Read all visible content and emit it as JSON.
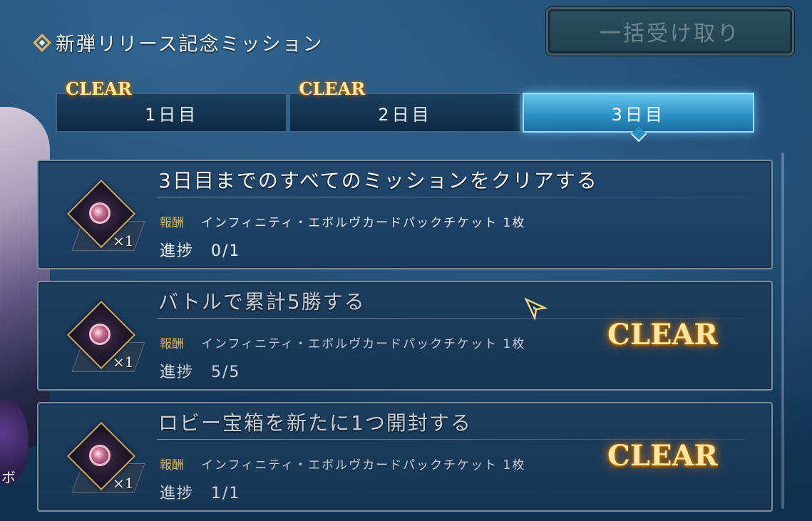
{
  "header": {
    "title": "新弾リリース記念ミッション",
    "bulk_receive_label": "一括受け取り"
  },
  "tabs": [
    {
      "label": "1日目",
      "badge": "CLEAR",
      "active": false
    },
    {
      "label": "2日目",
      "badge": "CLEAR",
      "active": false
    },
    {
      "label": "3日目",
      "badge": "",
      "active": true
    }
  ],
  "missions": [
    {
      "title": "3日目までのすべてのミッションをクリアする",
      "reward_label": "報酬",
      "reward": "インフィニティ・エボルヴカードパックチケット 1枚",
      "quantity": "×1",
      "progress": "進捗　0/1",
      "status": ""
    },
    {
      "title": "バトルで累計5勝する",
      "reward_label": "報酬",
      "reward": "インフィニティ・エボルヴカードパックチケット 1枚",
      "quantity": "×1",
      "progress": "進捗　5/5",
      "status": "CLEAR"
    },
    {
      "title": "ロビー宝箱を新たに1つ開封する",
      "reward_label": "報酬",
      "reward": "インフィニティ・エボルヴカードパックチケット 1枚",
      "quantity": "×1",
      "progress": "進捗　1/1",
      "status": "CLEAR"
    }
  ],
  "side_text": "ボ",
  "colors": {
    "clear_gold": "#ffe6a0",
    "reward_label": "#e0b64f",
    "active_tab": "#3aa6da"
  }
}
